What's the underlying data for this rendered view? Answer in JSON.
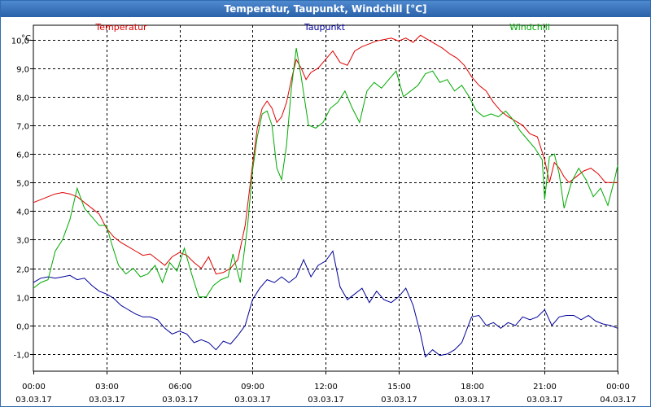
{
  "title": "Temperatur, Taupunkt, Windchill [°C]",
  "chart_data": {
    "type": "line",
    "title": "Temperatur, Taupunkt, Windchill [°C]",
    "ylabel": "°C",
    "xlabel": "",
    "ylim": [
      -1.6,
      10.5
    ],
    "xlim": [
      0,
      24
    ],
    "yticks": [
      -1.0,
      0.0,
      1.0,
      2.0,
      3.0,
      4.0,
      5.0,
      6.0,
      7.0,
      8.0,
      9.0,
      10.0
    ],
    "ytick_labels": [
      "-1,0",
      "0,0",
      "1,0",
      "2,0",
      "3,0",
      "4,0",
      "5,0",
      "6,0",
      "7,0",
      "8,0",
      "9,0",
      "10,0"
    ],
    "xticks": [
      {
        "hours": 0,
        "time": "00:00",
        "date": "03.03.17"
      },
      {
        "hours": 3,
        "time": "03:00",
        "date": "03.03.17"
      },
      {
        "hours": 6,
        "time": "06:00",
        "date": "03.03.17"
      },
      {
        "hours": 9,
        "time": "09:00",
        "date": "03.03.17"
      },
      {
        "hours": 12,
        "time": "12:00",
        "date": "03.03.17"
      },
      {
        "hours": 15,
        "time": "15:00",
        "date": "03.03.17"
      },
      {
        "hours": 18,
        "time": "18:00",
        "date": "03.03.17"
      },
      {
        "hours": 21,
        "time": "21:00",
        "date": "03.03.17"
      },
      {
        "hours": 24,
        "time": "00:00",
        "date": "04.03.17"
      }
    ],
    "grid": true,
    "legend_position": "top",
    "series": [
      {
        "name": "Temperatur",
        "color": "#e00000",
        "points": [
          [
            0,
            4.3
          ],
          [
            0.3,
            4.4
          ],
          [
            0.6,
            4.5
          ],
          [
            0.9,
            4.6
          ],
          [
            1.2,
            4.65
          ],
          [
            1.5,
            4.6
          ],
          [
            1.8,
            4.5
          ],
          [
            2.1,
            4.3
          ],
          [
            2.4,
            4.1
          ],
          [
            2.7,
            3.9
          ],
          [
            3.0,
            3.4
          ],
          [
            3.3,
            3.1
          ],
          [
            3.6,
            2.9
          ],
          [
            3.9,
            2.75
          ],
          [
            4.2,
            2.6
          ],
          [
            4.5,
            2.45
          ],
          [
            4.8,
            2.5
          ],
          [
            5.1,
            2.3
          ],
          [
            5.4,
            2.1
          ],
          [
            5.7,
            2.4
          ],
          [
            6.0,
            2.55
          ],
          [
            6.3,
            2.45
          ],
          [
            6.6,
            2.2
          ],
          [
            6.9,
            2.0
          ],
          [
            7.2,
            2.4
          ],
          [
            7.5,
            1.8
          ],
          [
            7.8,
            1.85
          ],
          [
            8.1,
            2.0
          ],
          [
            8.4,
            2.3
          ],
          [
            8.7,
            3.5
          ],
          [
            9.0,
            5.6
          ],
          [
            9.2,
            6.9
          ],
          [
            9.4,
            7.6
          ],
          [
            9.6,
            7.85
          ],
          [
            9.8,
            7.6
          ],
          [
            10.0,
            7.1
          ],
          [
            10.2,
            7.3
          ],
          [
            10.4,
            7.8
          ],
          [
            10.6,
            8.6
          ],
          [
            10.8,
            9.3
          ],
          [
            11.0,
            9.0
          ],
          [
            11.2,
            8.6
          ],
          [
            11.4,
            8.85
          ],
          [
            11.7,
            9.0
          ],
          [
            12.0,
            9.3
          ],
          [
            12.3,
            9.6
          ],
          [
            12.6,
            9.2
          ],
          [
            12.9,
            9.1
          ],
          [
            13.2,
            9.6
          ],
          [
            13.5,
            9.75
          ],
          [
            13.8,
            9.85
          ],
          [
            14.1,
            9.95
          ],
          [
            14.4,
            10.0
          ],
          [
            14.7,
            10.05
          ],
          [
            15.0,
            9.95
          ],
          [
            15.3,
            10.05
          ],
          [
            15.6,
            9.9
          ],
          [
            15.9,
            10.15
          ],
          [
            16.2,
            10.0
          ],
          [
            16.5,
            9.85
          ],
          [
            16.8,
            9.7
          ],
          [
            17.1,
            9.5
          ],
          [
            17.4,
            9.35
          ],
          [
            17.7,
            9.1
          ],
          [
            18.0,
            8.7
          ],
          [
            18.3,
            8.4
          ],
          [
            18.6,
            8.2
          ],
          [
            18.9,
            7.8
          ],
          [
            19.2,
            7.5
          ],
          [
            19.5,
            7.3
          ],
          [
            19.8,
            7.15
          ],
          [
            20.1,
            7.0
          ],
          [
            20.4,
            6.7
          ],
          [
            20.7,
            6.6
          ],
          [
            21.0,
            5.8
          ],
          [
            21.2,
            5.0
          ],
          [
            21.4,
            5.7
          ],
          [
            21.6,
            5.5
          ],
          [
            21.8,
            5.2
          ],
          [
            22.0,
            5.0
          ],
          [
            22.3,
            5.2
          ],
          [
            22.6,
            5.4
          ],
          [
            22.9,
            5.5
          ],
          [
            23.2,
            5.3
          ],
          [
            23.5,
            5.0
          ],
          [
            23.8,
            5.0
          ],
          [
            24.0,
            5.0
          ]
        ]
      },
      {
        "name": "Taupunkt",
        "color": "#000099",
        "points": [
          [
            0,
            1.5
          ],
          [
            0.3,
            1.65
          ],
          [
            0.6,
            1.7
          ],
          [
            0.9,
            1.65
          ],
          [
            1.2,
            1.7
          ],
          [
            1.5,
            1.75
          ],
          [
            1.8,
            1.6
          ],
          [
            2.1,
            1.65
          ],
          [
            2.4,
            1.4
          ],
          [
            2.7,
            1.2
          ],
          [
            3.0,
            1.1
          ],
          [
            3.3,
            0.95
          ],
          [
            3.6,
            0.7
          ],
          [
            3.9,
            0.55
          ],
          [
            4.2,
            0.4
          ],
          [
            4.5,
            0.3
          ],
          [
            4.8,
            0.3
          ],
          [
            5.1,
            0.2
          ],
          [
            5.4,
            -0.1
          ],
          [
            5.7,
            -0.3
          ],
          [
            6.0,
            -0.2
          ],
          [
            6.3,
            -0.3
          ],
          [
            6.6,
            -0.6
          ],
          [
            6.9,
            -0.5
          ],
          [
            7.2,
            -0.6
          ],
          [
            7.5,
            -0.85
          ],
          [
            7.8,
            -0.55
          ],
          [
            8.1,
            -0.65
          ],
          [
            8.4,
            -0.35
          ],
          [
            8.7,
            0.0
          ],
          [
            9.0,
            0.9
          ],
          [
            9.3,
            1.3
          ],
          [
            9.6,
            1.6
          ],
          [
            9.9,
            1.5
          ],
          [
            10.2,
            1.7
          ],
          [
            10.5,
            1.5
          ],
          [
            10.8,
            1.7
          ],
          [
            11.1,
            2.3
          ],
          [
            11.4,
            1.7
          ],
          [
            11.7,
            2.1
          ],
          [
            12.0,
            2.25
          ],
          [
            12.3,
            2.6
          ],
          [
            12.6,
            1.35
          ],
          [
            12.9,
            0.9
          ],
          [
            13.2,
            1.1
          ],
          [
            13.5,
            1.3
          ],
          [
            13.8,
            0.8
          ],
          [
            14.1,
            1.2
          ],
          [
            14.4,
            0.9
          ],
          [
            14.7,
            0.8
          ],
          [
            15.0,
            1.0
          ],
          [
            15.3,
            1.3
          ],
          [
            15.6,
            0.7
          ],
          [
            15.9,
            -0.3
          ],
          [
            16.1,
            -1.1
          ],
          [
            16.4,
            -0.85
          ],
          [
            16.7,
            -1.05
          ],
          [
            17.0,
            -1.0
          ],
          [
            17.3,
            -0.85
          ],
          [
            17.6,
            -0.6
          ],
          [
            18.0,
            0.3
          ],
          [
            18.3,
            0.35
          ],
          [
            18.6,
            0.0
          ],
          [
            18.9,
            0.1
          ],
          [
            19.2,
            -0.1
          ],
          [
            19.5,
            0.1
          ],
          [
            19.8,
            0.0
          ],
          [
            20.1,
            0.3
          ],
          [
            20.4,
            0.2
          ],
          [
            20.7,
            0.3
          ],
          [
            21.0,
            0.55
          ],
          [
            21.3,
            0.0
          ],
          [
            21.6,
            0.3
          ],
          [
            21.9,
            0.35
          ],
          [
            22.2,
            0.35
          ],
          [
            22.5,
            0.2
          ],
          [
            22.8,
            0.35
          ],
          [
            23.1,
            0.15
          ],
          [
            23.4,
            0.05
          ],
          [
            23.7,
            0.0
          ],
          [
            24.0,
            -0.1
          ]
        ]
      },
      {
        "name": "Windchill",
        "color": "#00aa00",
        "points": [
          [
            0,
            1.3
          ],
          [
            0.3,
            1.5
          ],
          [
            0.6,
            1.6
          ],
          [
            0.9,
            2.6
          ],
          [
            1.2,
            3.0
          ],
          [
            1.5,
            3.7
          ],
          [
            1.8,
            4.8
          ],
          [
            2.1,
            4.1
          ],
          [
            2.4,
            3.8
          ],
          [
            2.7,
            3.5
          ],
          [
            3.0,
            3.5
          ],
          [
            3.2,
            2.9
          ],
          [
            3.5,
            2.1
          ],
          [
            3.8,
            1.8
          ],
          [
            4.1,
            2.0
          ],
          [
            4.4,
            1.7
          ],
          [
            4.7,
            1.8
          ],
          [
            5.0,
            2.1
          ],
          [
            5.3,
            1.5
          ],
          [
            5.6,
            2.2
          ],
          [
            5.9,
            1.9
          ],
          [
            6.2,
            2.7
          ],
          [
            6.5,
            1.8
          ],
          [
            6.8,
            1.0
          ],
          [
            7.1,
            1.0
          ],
          [
            7.4,
            1.4
          ],
          [
            7.7,
            1.6
          ],
          [
            8.0,
            1.7
          ],
          [
            8.2,
            2.5
          ],
          [
            8.5,
            1.5
          ],
          [
            8.8,
            3.5
          ],
          [
            9.0,
            5.4
          ],
          [
            9.2,
            6.6
          ],
          [
            9.4,
            7.4
          ],
          [
            9.6,
            7.5
          ],
          [
            9.8,
            7.0
          ],
          [
            10.0,
            5.5
          ],
          [
            10.2,
            5.1
          ],
          [
            10.4,
            6.3
          ],
          [
            10.6,
            8.3
          ],
          [
            10.8,
            9.7
          ],
          [
            11.0,
            8.7
          ],
          [
            11.3,
            7.0
          ],
          [
            11.6,
            6.9
          ],
          [
            11.9,
            7.1
          ],
          [
            12.2,
            7.6
          ],
          [
            12.5,
            7.8
          ],
          [
            12.8,
            8.2
          ],
          [
            13.1,
            7.6
          ],
          [
            13.4,
            7.1
          ],
          [
            13.7,
            8.2
          ],
          [
            14.0,
            8.5
          ],
          [
            14.3,
            8.3
          ],
          [
            14.6,
            8.6
          ],
          [
            14.9,
            8.9
          ],
          [
            15.2,
            8.0
          ],
          [
            15.5,
            8.2
          ],
          [
            15.8,
            8.4
          ],
          [
            16.1,
            8.8
          ],
          [
            16.4,
            8.9
          ],
          [
            16.7,
            8.5
          ],
          [
            17.0,
            8.6
          ],
          [
            17.3,
            8.2
          ],
          [
            17.6,
            8.4
          ],
          [
            17.9,
            8.0
          ],
          [
            18.2,
            7.5
          ],
          [
            18.5,
            7.3
          ],
          [
            18.8,
            7.4
          ],
          [
            19.1,
            7.3
          ],
          [
            19.4,
            7.5
          ],
          [
            19.7,
            7.2
          ],
          [
            20.0,
            6.8
          ],
          [
            20.3,
            6.5
          ],
          [
            20.6,
            6.2
          ],
          [
            20.9,
            5.8
          ],
          [
            21.0,
            4.4
          ],
          [
            21.2,
            5.9
          ],
          [
            21.4,
            6.0
          ],
          [
            21.6,
            5.3
          ],
          [
            21.8,
            4.1
          ],
          [
            22.1,
            5.0
          ],
          [
            22.4,
            5.5
          ],
          [
            22.7,
            5.1
          ],
          [
            23.0,
            4.5
          ],
          [
            23.3,
            4.8
          ],
          [
            23.6,
            4.2
          ],
          [
            23.9,
            5.2
          ],
          [
            24.0,
            5.6
          ]
        ]
      }
    ]
  }
}
